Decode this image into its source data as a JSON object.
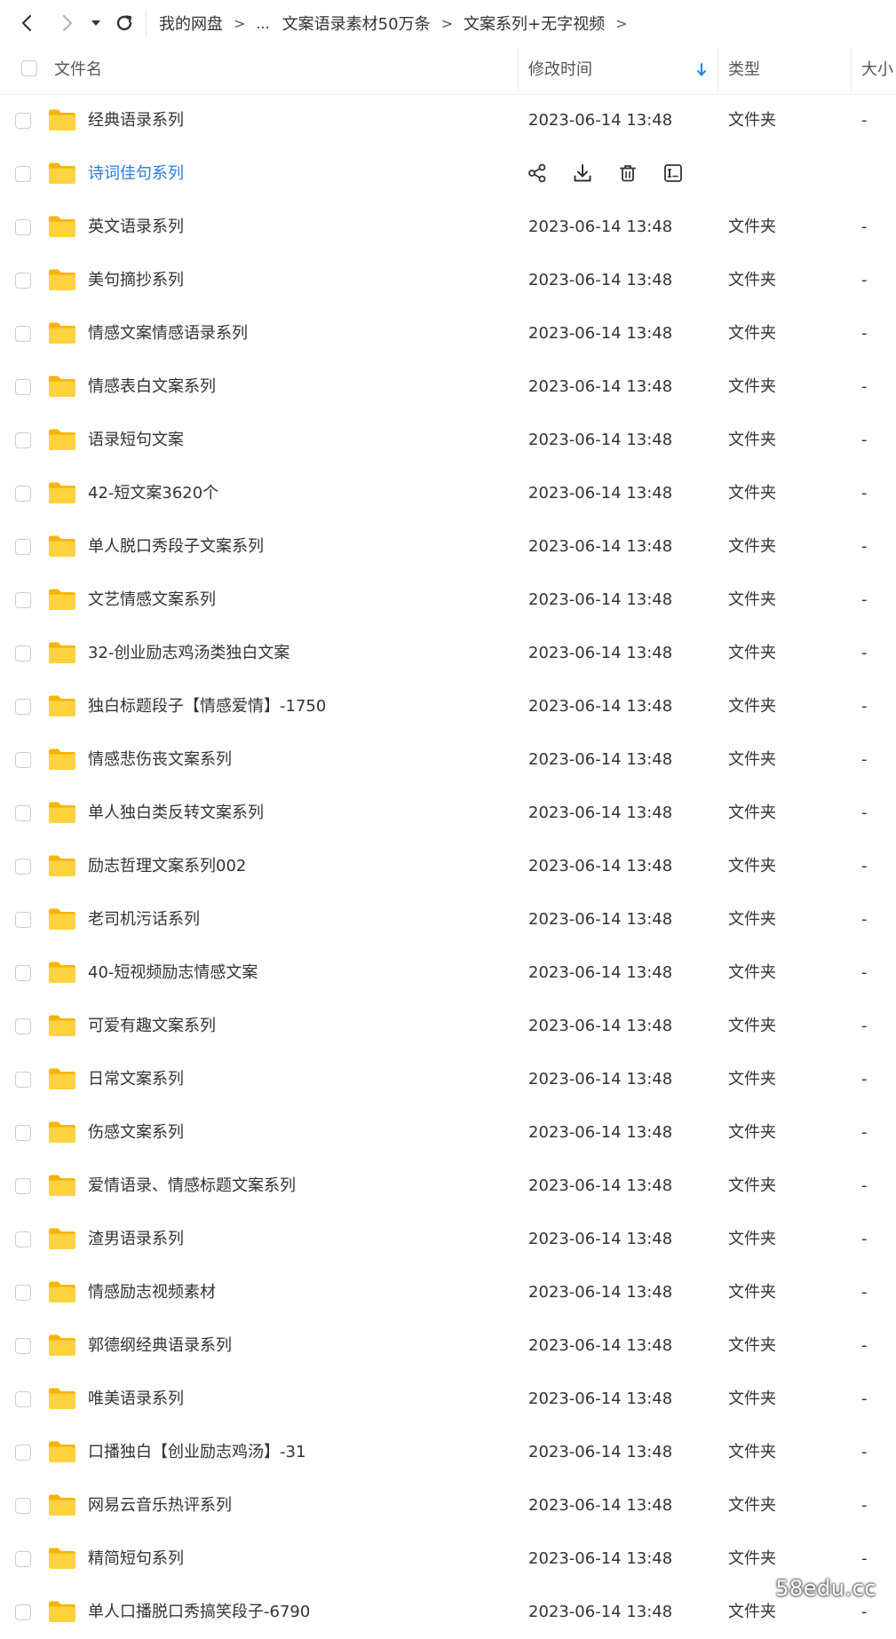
{
  "nav": {
    "back_icon": "chevron-left-icon",
    "forward_icon": "chevron-right-icon",
    "dropdown_icon": "caret-down-icon",
    "refresh_icon": "refresh-icon",
    "breadcrumb": {
      "root": "我的网盘",
      "ellipsis": "...",
      "parent": "文案语录素材50万条",
      "current": "文案系列+无字视频",
      "separator": ">"
    }
  },
  "table": {
    "columns": {
      "name": "文件名",
      "modified": "修改时间",
      "type": "类型",
      "size": "大小"
    },
    "sort": {
      "column": "modified",
      "direction": "descending",
      "icon": "arrow-down-icon",
      "color": "#1a86e8"
    },
    "hover_actions": [
      "share-icon",
      "download-icon",
      "delete-icon",
      "rename-icon"
    ],
    "rows": [
      {
        "name": "经典语录系列",
        "time": "2023-06-14 13:48",
        "type": "文件夹",
        "size": "-"
      },
      {
        "name": "诗词佳句系列",
        "time": "",
        "type": "",
        "size": "",
        "hovered": true
      },
      {
        "name": "英文语录系列",
        "time": "2023-06-14 13:48",
        "type": "文件夹",
        "size": "-"
      },
      {
        "name": "美句摘抄系列",
        "time": "2023-06-14 13:48",
        "type": "文件夹",
        "size": "-"
      },
      {
        "name": "情感文案情感语录系列",
        "time": "2023-06-14 13:48",
        "type": "文件夹",
        "size": "-"
      },
      {
        "name": "情感表白文案系列",
        "time": "2023-06-14 13:48",
        "type": "文件夹",
        "size": "-"
      },
      {
        "name": "语录短句文案",
        "time": "2023-06-14 13:48",
        "type": "文件夹",
        "size": "-"
      },
      {
        "name": "42-短文案3620个",
        "time": "2023-06-14 13:48",
        "type": "文件夹",
        "size": "-"
      },
      {
        "name": "单人脱口秀段子文案系列",
        "time": "2023-06-14 13:48",
        "type": "文件夹",
        "size": "-"
      },
      {
        "name": "文艺情感文案系列",
        "time": "2023-06-14 13:48",
        "type": "文件夹",
        "size": "-"
      },
      {
        "name": "32-创业励志鸡汤类独白文案",
        "time": "2023-06-14 13:48",
        "type": "文件夹",
        "size": "-"
      },
      {
        "name": "独白标题段子【情感爱情】-1750",
        "time": "2023-06-14 13:48",
        "type": "文件夹",
        "size": "-"
      },
      {
        "name": "情感悲伤丧文案系列",
        "time": "2023-06-14 13:48",
        "type": "文件夹",
        "size": "-"
      },
      {
        "name": "单人独白类反转文案系列",
        "time": "2023-06-14 13:48",
        "type": "文件夹",
        "size": "-"
      },
      {
        "name": "励志哲理文案系列002",
        "time": "2023-06-14 13:48",
        "type": "文件夹",
        "size": "-"
      },
      {
        "name": "老司机污话系列",
        "time": "2023-06-14 13:48",
        "type": "文件夹",
        "size": "-"
      },
      {
        "name": "40-短视频励志情感文案",
        "time": "2023-06-14 13:48",
        "type": "文件夹",
        "size": "-"
      },
      {
        "name": "可爱有趣文案系列",
        "time": "2023-06-14 13:48",
        "type": "文件夹",
        "size": "-"
      },
      {
        "name": "日常文案系列",
        "time": "2023-06-14 13:48",
        "type": "文件夹",
        "size": "-"
      },
      {
        "name": "伤感文案系列",
        "time": "2023-06-14 13:48",
        "type": "文件夹",
        "size": "-"
      },
      {
        "name": "爱情语录、情感标题文案系列",
        "time": "2023-06-14 13:48",
        "type": "文件夹",
        "size": "-"
      },
      {
        "name": "渣男语录系列",
        "time": "2023-06-14 13:48",
        "type": "文件夹",
        "size": "-"
      },
      {
        "name": "情感励志视频素材",
        "time": "2023-06-14 13:48",
        "type": "文件夹",
        "size": "-"
      },
      {
        "name": "郭德纲经典语录系列",
        "time": "2023-06-14 13:48",
        "type": "文件夹",
        "size": "-"
      },
      {
        "name": "唯美语录系列",
        "time": "2023-06-14 13:48",
        "type": "文件夹",
        "size": "-"
      },
      {
        "name": "口播独白【创业励志鸡汤】-31",
        "time": "2023-06-14 13:48",
        "type": "文件夹",
        "size": "-"
      },
      {
        "name": "网易云音乐热评系列",
        "time": "2023-06-14 13:48",
        "type": "文件夹",
        "size": "-"
      },
      {
        "name": "精简短句系列",
        "time": "2023-06-14 13:48",
        "type": "文件夹",
        "size": "-"
      },
      {
        "name": "单人口播脱口秀搞笑段子-6790",
        "time": "2023-06-14 13:48",
        "type": "文件夹",
        "size": "-"
      }
    ]
  },
  "colors": {
    "folder": "#ffc928",
    "folder_tab": "#f5b400",
    "hover_link": "#2a7ae2",
    "text": "#333333"
  },
  "watermark": "58edu.cc"
}
